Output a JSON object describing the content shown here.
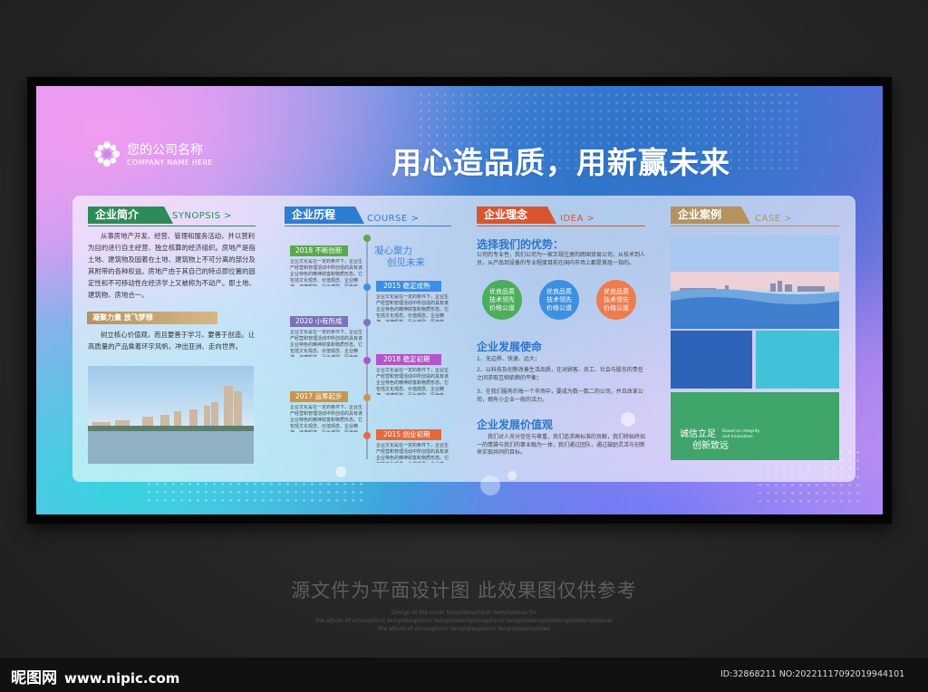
{
  "header": {
    "company_name": "您的公司名称",
    "company_en": "COMPANY NAME HERE",
    "main_title": "用心造品质，用新赢未来"
  },
  "sections": {
    "synopsis": {
      "tag": "企业简介",
      "en": "SYNOPSIS >",
      "color": "#2e8b57",
      "body": "从事房地产开发、经营、管理和服务活动，并以营利为目的进行自主经营、独立核算的经济组织。房地产是指土地、建筑物及固着在土地、建筑物上不可分离的部分及其附带的各种权益。房地产由于其自己的特点即位置的固定性和不可移动性在经济学上又被称为不动产。即土地、建筑物、房地合一。",
      "subhead": "凝聚力量 放飞梦想",
      "sub_body": "树立核心价值观，而且要善于学习，要善于创造。让高质量的产品乘着环宇风帆，冲出亚洲、走向世界。"
    },
    "course": {
      "tag": "企业历程",
      "en": "COURSE >",
      "color": "#2e7dd1",
      "headline": [
        "凝心聚力",
        "创见未来"
      ],
      "items": [
        {
          "year": "2018 不断创新",
          "color": "#5aa94c",
          "text": "企业文化是在一定的条件下，企业生产经营和管理活动中所创造的具有该企业特色的精神财富和物质形态。它包括文化观念、价值观念、企业精神、道德规范、行为准则、历史传统、企业制度、文化环境、企业产品等。"
        },
        {
          "year": "2015 稳定成熟",
          "color": "#3c8fe0",
          "text": "企业文化是在一定的条件下，企业生产经营和管理活动中所创造的具有该企业特色的精神财富和物质形态。它包括文化观念、价值观念、企业精神、道德规范、行为准则、历史传统、企业制度、文化环境、企业产品等。"
        },
        {
          "year": "2020 小有所成",
          "color": "#7b73b8",
          "text": "企业文化是在一定的条件下，企业生产经营和管理活动中所创造的具有该企业特色的精神财富和物质形态。它包括文化观念、价值观念、企业精神、道德规范、行为准则、历史传统、企业制度、文化环境、企业产品等。"
        },
        {
          "year": "2018 稳定初期",
          "color": "#b255c6",
          "text": "企业文化是在一定的条件下，企业生产经营和管理活动中所创造的具有该企业特色的精神财富和物质形态。它包括文化观念、价值观念、企业精神、道德规范、行为准则、历史传统、企业制度、文化环境、企业产品等。"
        },
        {
          "year": "2017 运筹起步",
          "color": "#c9964d",
          "text": "企业文化是在一定的条件下，企业生产经营和管理活动中所创造的具有该企业特色的精神财富和物质形态。它包括文化观念、价值观念、企业精神、道德规范、行为准则、历史传统、企业制度、文化环境、企业产品等。"
        },
        {
          "year": "2015 创业初期",
          "color": "#e46a3d",
          "text": "企业文化是在一定的条件下，企业生产经营和管理活动中所创造的具有该企业特色的精神财富和物质形态。它包括文化观念、价值观念、企业精神、道德规范、行为准则、历史传统、企业制度、文化环境、企业产品等。"
        }
      ]
    },
    "idea": {
      "tag": "企业理念",
      "en": "IDEA >",
      "color": "#d9552d",
      "advantage_title": "选择我们的优势：",
      "advantage_body": "公司的专业性，我们公司为一家正规注册的跨国贸易公司，从技术到人员，从产品到设备的专业程度目前在国内市场上都是首屈一指的。",
      "circles": [
        {
          "text": [
            "优良品质",
            "技术领先",
            "价格公道"
          ],
          "color": "#4cae5a"
        },
        {
          "text": [
            "优良品质",
            "技术领先",
            "价格公道"
          ],
          "color": "#3d8fe0"
        },
        {
          "text": [
            "优良品质",
            "技术领先",
            "价格公道"
          ],
          "color": "#ef7c4f"
        }
      ],
      "mission_title": "企业发展使命",
      "mission_items": [
        "1、无边界、快速、远大；",
        "2、以科技及创新改善生活品质，在对顾客、员工、社会与股东的责任之间求取互相依赖的平衡；",
        "3、在我们服务的每一个市场中，要成为数一数二的公司，并且改革公司，拥有小企业一般的活力。"
      ],
      "values_title": "企业发展价值观",
      "values_body": "我们对人充分信任与尊重，我们追求高标准的贡献，我们将始终如一的情操与我们的事业融为一体，我们通过团队，通过鼓励灵活与创新来实现共同的目标。"
    },
    "case": {
      "tag": "企业案例",
      "en": "CASE >",
      "color": "#b5925e",
      "tile_text": [
        "诚信立足",
        "创新致远"
      ],
      "tile_small": [
        "Based on integrity",
        "and innovation"
      ],
      "tiles": [
        "#2d63b8",
        "#41c2d8",
        "#3fa56a"
      ]
    }
  },
  "caption": {
    "main": "源文件为平面设计图 此效果图仅供参考",
    "small_lines": [
      "Design of the cover templatesphenic templatesse for",
      "the album of atmospheric templatesphenic templatetemplatesphenic templatetemplatetemplatetemplatesst",
      "the album of atmospheric templatesphenic templatetemplates"
    ]
  },
  "footer": {
    "site_name": "昵图网",
    "site_url": "www.nipic.com",
    "id_text": "ID:32868211 NO:20221117092019944101"
  }
}
